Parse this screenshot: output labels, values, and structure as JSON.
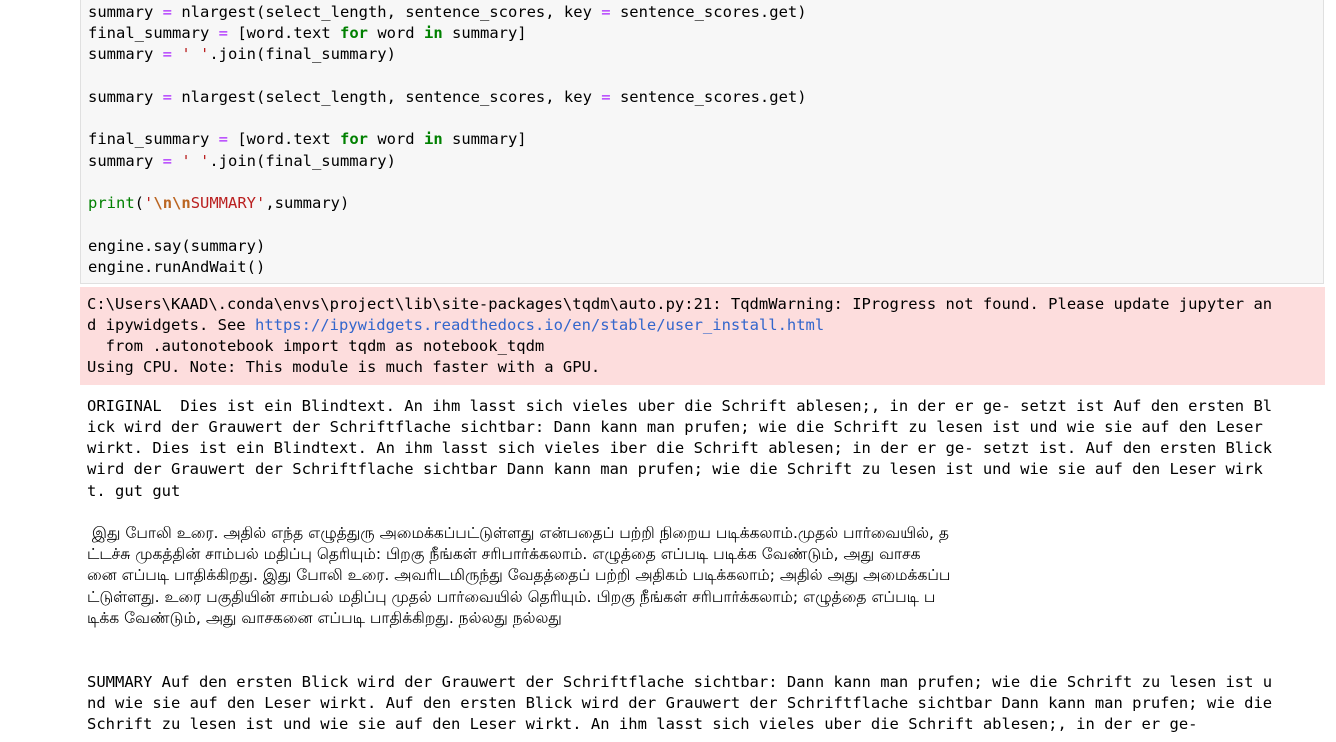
{
  "code": {
    "l1": [
      "summary",
      " = ",
      "nlargest(select_length, sentence_scores, key ",
      "= ",
      "sentence_scores.get)"
    ],
    "l2": [
      "final_summary",
      " = ",
      "[word.text ",
      "for",
      " word ",
      "in",
      " summary]"
    ],
    "l3": [
      "summary",
      " = ",
      "' '",
      ".join(final_summary)"
    ],
    "l4": [
      "summary",
      " = ",
      "nlargest(select_length, sentence_scores, key ",
      "= ",
      "sentence_scores.get)"
    ],
    "l5": [
      "final_summary",
      " = ",
      "[word.text ",
      "for",
      " word ",
      "in",
      " summary]"
    ],
    "l6": [
      "summary",
      " = ",
      "' '",
      ".join(final_summary)"
    ],
    "l7": [
      "print",
      "(",
      "'",
      "\\n\\n",
      "SUMMARY'",
      ",summary)"
    ],
    "l8": "engine.say(summary)",
    "l9": "engine.runAndWait()"
  },
  "stderr": {
    "line1": "C:\\Users\\KAAD\\.conda\\envs\\project\\lib\\site-packages\\tqdm\\auto.py:21: TqdmWarning: IProgress not found. Please update jupyter an",
    "line2_prefix": "d ipywidgets. See ",
    "line2_link": "https://ipywidgets.readthedocs.io/en/stable/user_install.html",
    "line3": "  from .autonotebook import tqdm as notebook_tqdm",
    "line4": "Using CPU. Note: This module is much faster with a GPU."
  },
  "original": [
    "ORIGINAL  Dies ist ein Blindtext. An ihm lasst sich vieles uber die Schrift ablesen;, in der er ge- setzt ist Auf den ersten Bl",
    "ick wird der Grauwert der Schriftflache sichtbar: Dann kann man prufen; wie die Schrift zu lesen ist und wie sie auf den Leser",
    "wirkt. Dies ist ein Blindtext. An ihm lasst sich vieles iber die Schrift ablesen; in der er ge- setzt ist. Auf den ersten Blick",
    "wird der Grauwert der Schriftflache sichtbar Dann kann man prufen; wie die Schrift zu lesen ist und wie sie auf den Leser wirk",
    "t. gut gut"
  ],
  "tamil": [
    " இது போலி உரை. அதில் எந்த எழுத்துரு அமைக்கப்பட்டுள்ளது என்பதைப் பற்றி நிறைய படிக்கலாம்.முதல் பார்வையில், த",
    "ட்டச்சு முகத்தின் சாம்பல் மதிப்பு தெரியும்: பிறகு நீங்கள் சரிபார்க்கலாம். எழுத்தை எப்படி படிக்க வேண்டும், அது வாசக",
    "னை எப்படி பாதிக்கிறது. இது போலி உரை. அவரிடமிருந்து வேதத்தைப் பற்றி அதிகம் படிக்கலாம்; அதில் அது அமைக்கப்ப",
    "ட்டுள்ளது. உரை பகுதியின் சாம்பல் மதிப்பு முதல் பார்வையில் தெரியும். பிறகு நீங்கள் சரிபார்க்கலாம்; எழுத்தை எப்படி ப",
    "டிக்க வேண்டும், அது வாசகனை எப்படி பாதிக்கிறது. நல்லது நல்லது"
  ],
  "summary": [
    "SUMMARY Auf den ersten Blick wird der Grauwert der Schriftflache sichtbar: Dann kann man prufen; wie die Schrift zu lesen ist u",
    "nd wie sie auf den Leser wirkt. Auf den ersten Blick wird der Grauwert der Schriftflache sichtbar Dann kann man prufen; wie die",
    "Schrift zu lesen ist und wie sie auf den Leser wirkt. An ihm lasst sich vieles uber die Schrift ablesen;, in der er ge-"
  ]
}
